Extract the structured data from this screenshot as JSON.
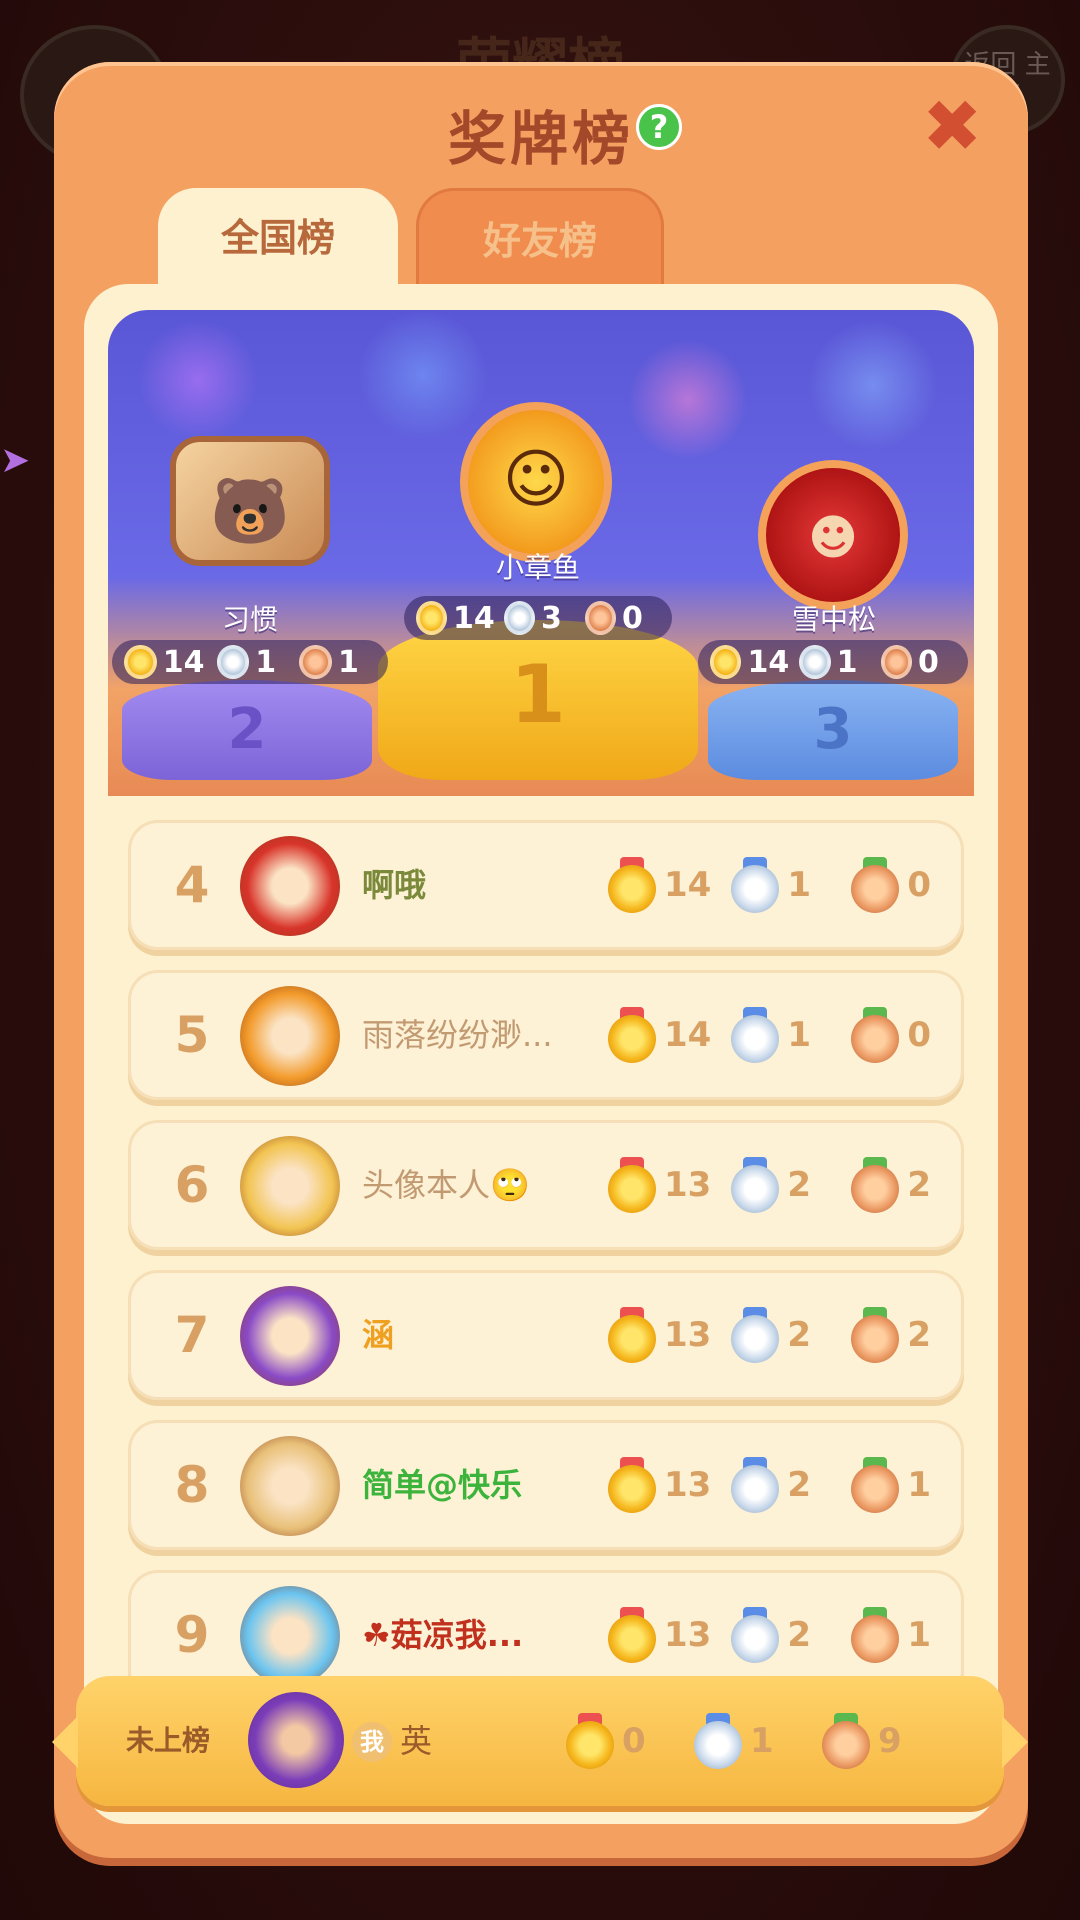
{
  "background": {
    "title": "荣耀榜",
    "return_button": "返回\n主页"
  },
  "modal": {
    "title": "奖牌榜",
    "help_glyph": "?",
    "close_glyph": "✖"
  },
  "tabs": [
    {
      "label": "全国榜",
      "active": true
    },
    {
      "label": "好友榜",
      "active": false
    }
  ],
  "podium": {
    "first": {
      "rank": "1",
      "name": "小章鱼",
      "gold": "14",
      "silver": "3",
      "bronze": "0"
    },
    "second": {
      "rank": "2",
      "name": "习惯",
      "gold": "14",
      "silver": "1",
      "bronze": "1"
    },
    "third": {
      "rank": "3",
      "name": "雪中松",
      "gold": "14",
      "silver": "1",
      "bronze": "0"
    }
  },
  "rows": [
    {
      "rank": "4",
      "name": "啊哦",
      "name_color": "#7a8a3a",
      "gold": "14",
      "silver": "1",
      "bronze": "0",
      "avatar_color": "#d8342a"
    },
    {
      "rank": "5",
      "name": "雨落纷纷渺...",
      "name_color": "#c29a72",
      "gold": "14",
      "silver": "1",
      "bronze": "0",
      "avatar_color": "#f29a2a"
    },
    {
      "rank": "6",
      "name": "头像本人🙄",
      "name_color": "#c29a72",
      "gold": "13",
      "silver": "2",
      "bronze": "2",
      "avatar_color": "#f2c452"
    },
    {
      "rank": "7",
      "name": "涵",
      "name_color": "#f0a020",
      "gold": "13",
      "silver": "2",
      "bronze": "2",
      "avatar_color": "#8a4ac6"
    },
    {
      "rank": "8",
      "name": "简单@快乐",
      "name_color": "#3cb43c",
      "gold": "13",
      "silver": "2",
      "bronze": "1",
      "avatar_color": "#e8c078"
    },
    {
      "rank": "9",
      "name": "☘菇凉我...",
      "name_color": "#c0301c",
      "gold": "13",
      "silver": "2",
      "bronze": "1",
      "avatar_color": "#6ac4f0"
    }
  ],
  "my_entry": {
    "status": "未上榜",
    "me_badge": "我",
    "name": "英",
    "gold": "0",
    "silver": "1",
    "bronze": "9"
  },
  "colors": {
    "modal_orange": "#f4a060",
    "panel_cream": "#fdf1d0",
    "title_red": "#a4482a",
    "rank_tan": "#d8a062"
  }
}
